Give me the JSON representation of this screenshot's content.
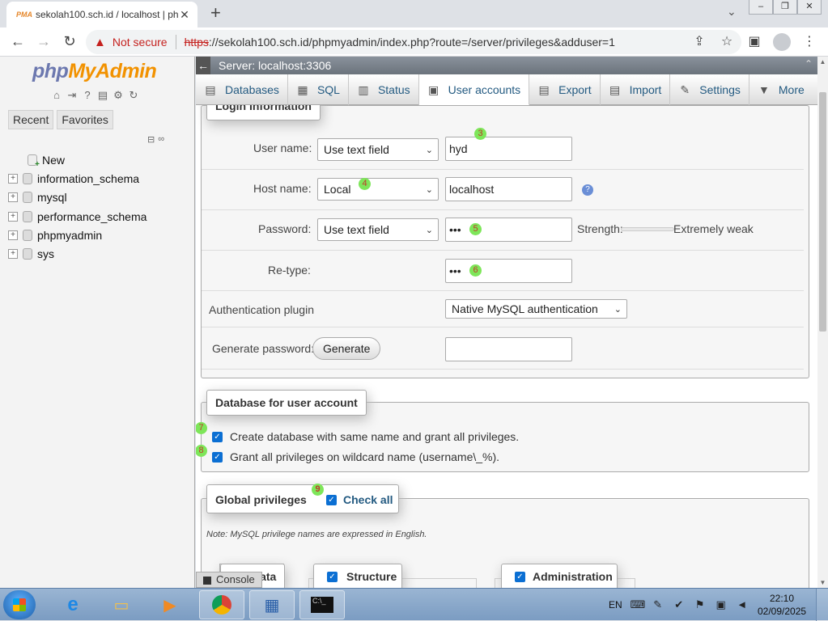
{
  "browser": {
    "tab_title": "sekolah100.sch.id / localhost | ph",
    "tab_close": "✕",
    "new_tab": "+",
    "not_secure": "Not secure",
    "url_scheme": "https",
    "url_rest": "://sekolah100.sch.id/phpmyadmin/index.php?route=/server/privileges&adduser=1"
  },
  "nav": {
    "logo_php": "php",
    "logo_my": "MyAdmin",
    "recent": "Recent",
    "favorites": "Favorites",
    "tree": [
      {
        "label": "New"
      },
      {
        "label": "information_schema"
      },
      {
        "label": "mysql"
      },
      {
        "label": "performance_schema"
      },
      {
        "label": "phpmyadmin"
      },
      {
        "label": "sys"
      }
    ]
  },
  "serverbar": {
    "server": "Server: localhost:3306"
  },
  "menu": {
    "tabs": [
      {
        "label": "Databases",
        "icon": "database-icon"
      },
      {
        "label": "SQL",
        "icon": "sql-icon"
      },
      {
        "label": "Status",
        "icon": "status-icon"
      },
      {
        "label": "User accounts",
        "icon": "users-icon"
      },
      {
        "label": "Export",
        "icon": "export-icon"
      },
      {
        "label": "Import",
        "icon": "import-icon"
      },
      {
        "label": "Settings",
        "icon": "settings-icon"
      },
      {
        "label": "More",
        "icon": "caret-down-icon"
      }
    ]
  },
  "login": {
    "legend": "Login Information",
    "user_name_label": "User name:",
    "user_name_mode": "Use text field",
    "user_name_value": "hyd",
    "host_name_label": "Host name:",
    "host_name_mode": "Local",
    "host_name_value": "localhost",
    "password_label": "Password:",
    "password_mode": "Use text field",
    "password_value": "•••",
    "strength_label": "Strength:",
    "strength_value": "Extremely weak",
    "retype_label": "Re-type:",
    "retype_value": "•••",
    "auth_plugin_label": "Authentication plugin",
    "auth_plugin_value": "Native MySQL authentication",
    "generate_label": "Generate password:",
    "generate_button": "Generate",
    "generate_value": ""
  },
  "annotations": {
    "a3": "3",
    "a4": "4",
    "a5": "5",
    "a6": "6",
    "a7": "7",
    "a8": "8",
    "a9": "9"
  },
  "database": {
    "legend": "Database for user account",
    "create_db": "Create database with same name and grant all privileges.",
    "grant_wildcard": "Grant all privileges on wildcard name (username\\_%)."
  },
  "global": {
    "legend": "Global privileges",
    "check_all": "Check all",
    "note": "Note: MySQL privilege names are expressed in English.",
    "data_label": "Data",
    "structure_label": "Structure",
    "administration_label": "Administration"
  },
  "console": {
    "label": "Console"
  },
  "taskbar": {
    "lang": "EN",
    "time": "22:10",
    "date": "02/09/2025"
  },
  "colors": {
    "accent_blue": "#235a81",
    "danger": "#c5221f",
    "badge_green": "#7ee65a",
    "checkbox_blue": "#0b6fd3"
  }
}
